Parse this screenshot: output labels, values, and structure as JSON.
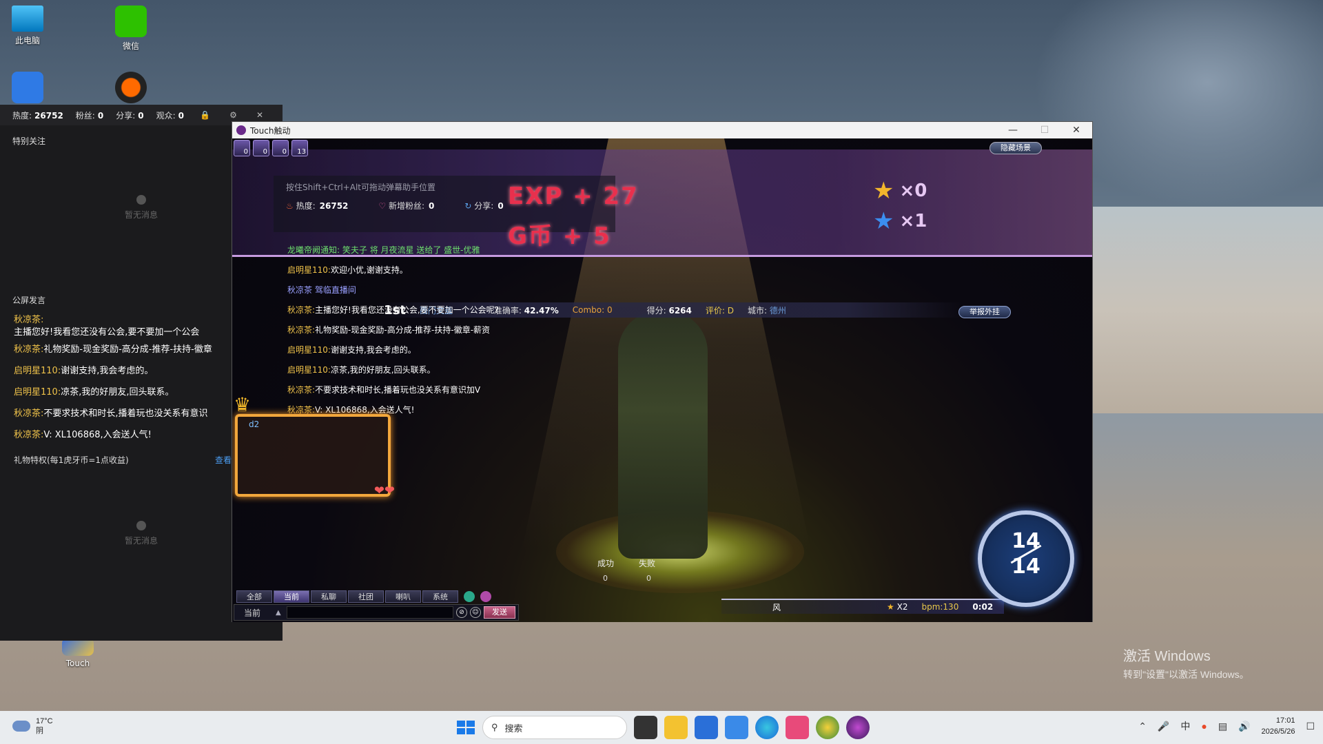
{
  "desktop": {
    "icons": [
      {
        "label": "此电脑"
      },
      {
        "label": "微信"
      },
      {
        "label": "Touch"
      }
    ],
    "watermark": {
      "line1": "激活 Windows",
      "line2": "转到\"设置\"以激活 Windows。"
    }
  },
  "live_panel": {
    "stats": {
      "heat_label": "热度:",
      "heat_value": "26752",
      "fans_label": "粉丝:",
      "fans_value": "0",
      "share_label": "分享:",
      "share_value": "0",
      "viewers_label": "观众:",
      "viewers_value": "0"
    },
    "special_follow_title": "特别关注",
    "empty_text": "暂无消息",
    "public_chat_title": "公屏发言",
    "chat": [
      {
        "nick": "秋凉茶:",
        "text": ""
      },
      {
        "nick": "",
        "text": "主播您好!我看您还没有公会,要不要加一个公会"
      },
      {
        "nick": "秋凉茶:",
        "text": "礼物奖励-现金奖励-高分成-推荐-扶持-徽章"
      },
      {
        "nick": "启明星110:",
        "text": "谢谢支持,我会考虑的。"
      },
      {
        "nick": "启明星110:",
        "text": "凉茶,我的好朋友,回头联系。"
      },
      {
        "nick": "秋凉茶:",
        "text": "不要求技术和时长,播着玩也没关系有意识"
      },
      {
        "nick": "秋凉茶:",
        "text": "V: XL106868,入会送人气!"
      }
    ],
    "gift_title": "礼物特权(每1虎牙币=1点收益)",
    "gift_more": "查看",
    "empty_text_2": "暂无消息"
  },
  "game_window": {
    "title": "Touch触动",
    "hide_scene_label": "隐藏场景",
    "top_icon_counts": [
      "0",
      "0",
      "0",
      "13"
    ],
    "overlay_hint": "按住Shift+Ctrl+Alt可拖动弹幕助手位置",
    "overlay_stats": {
      "heat_label": "热度:",
      "heat_value": "26752",
      "fans_label": "新增粉丝:",
      "fans_value": "0",
      "share_label": "分享:",
      "share_value": "0"
    },
    "exp_text": "EXP + 27",
    "gb_text": "G币 + 5",
    "gold_star_count": "×0",
    "blue_star_count": "×1",
    "score_bar": {
      "rank": "1st",
      "player": "西门文蓝",
      "accuracy_label": "准确率:",
      "accuracy_value": "42.47%",
      "combo_label": "Combo:",
      "combo_value": "0",
      "score_label": "得分:",
      "score_value": "6264",
      "rating_label": "评价:",
      "rating_value": "D",
      "city_label": "城市:",
      "city_value": "德州"
    },
    "report_label": "举报外挂",
    "chat": [
      {
        "type": "notice",
        "nick": "龙曦帝阙通知:",
        "text": "笑夫子 将 月夜流星 送给了 盛世-优雅"
      },
      {
        "type": "msg",
        "nick": "启明星110:",
        "text": "欢迎小优,谢谢支持。"
      },
      {
        "type": "sys",
        "nick": "",
        "text": "秋凉茶 驾临直播间"
      },
      {
        "type": "msg",
        "nick": "秋凉茶:",
        "text": "主播您好!我看您还没有公会,要不要加一个公会呢?"
      },
      {
        "type": "msg",
        "nick": "秋凉茶:",
        "text": "礼物奖励-现金奖励-高分成-推荐-扶持-徽章-薪资"
      },
      {
        "type": "msg",
        "nick": "启明星110:",
        "text": "谢谢支持,我会考虑的。"
      },
      {
        "type": "msg",
        "nick": "启明星110:",
        "text": "凉茶,我的好朋友,回头联系。"
      },
      {
        "type": "msg",
        "nick": "秋凉茶:",
        "text": "不要求技术和时长,播着玩也没关系有意识加V"
      },
      {
        "type": "msg",
        "nick": "秋凉茶:",
        "text": "V: XL106868,入会送人气!"
      }
    ],
    "avatar_label": "d2",
    "judge": {
      "success_label": "成功",
      "fail_label": "失败",
      "success_value": "0",
      "fail_value": "0"
    },
    "progress": {
      "current": "14",
      "total": "14"
    },
    "song": {
      "name": "风",
      "multiplier": "X2",
      "bpm": "bpm:130",
      "time": "0:02"
    },
    "chat_tabs": [
      "全部",
      "当前",
      "私聊",
      "社团",
      "喇叭",
      "系统"
    ],
    "active_tab": "当前",
    "input_scope": "当前",
    "send_label": "发送"
  },
  "taskbar": {
    "weather_temp": "17°C",
    "weather_desc": "阴",
    "search_placeholder": "搜索",
    "time": "17:01",
    "date": "2026/5/26"
  },
  "colors": {
    "accent_gold": "#f0c34a",
    "notice_green": "#6ee06e",
    "reward_red": "#e8304d",
    "send_pink": "#c8648a"
  }
}
